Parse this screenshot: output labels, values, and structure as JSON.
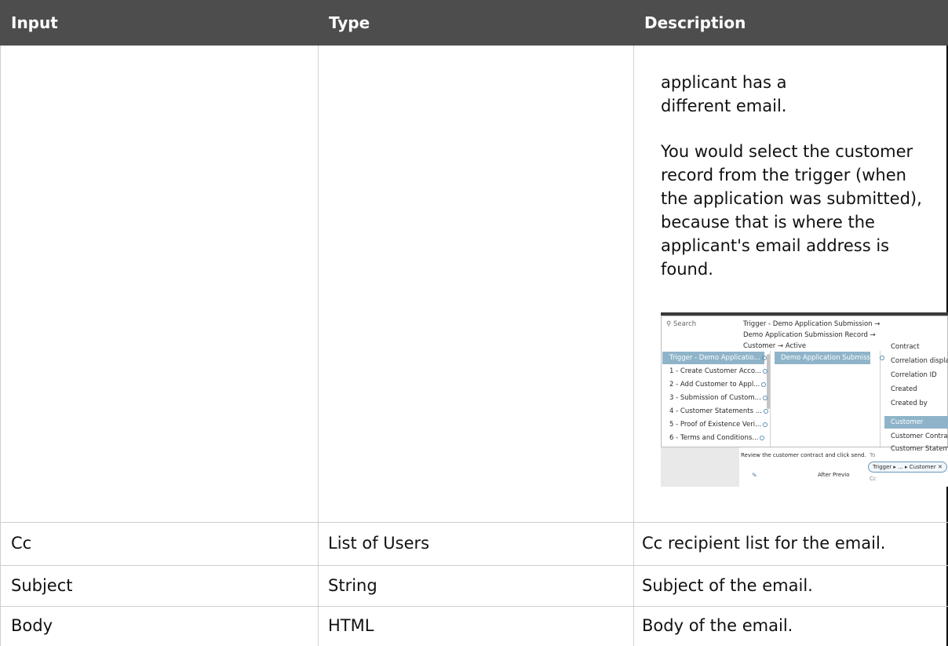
{
  "table": {
    "headers": [
      "Input",
      "Type",
      "Description"
    ],
    "description_continued": [
      "applicant has a different email.",
      "You would select the customer record from the trigger (when the application was submitted), because that is where the applicant's email address is found."
    ],
    "rows": [
      {
        "input": "Cc",
        "type": "List of Users",
        "description": "Cc recipient list for the email."
      },
      {
        "input": "Subject",
        "type": "String",
        "description": "Subject of the email."
      },
      {
        "input": "Body",
        "type": "HTML",
        "description": "Body of the email."
      }
    ]
  },
  "screenshot": {
    "search_placeholder": "Search",
    "breadcrumbs": [
      "Trigger - Demo Application Submission →",
      "Demo Application Submission Record →",
      "Customer → Active"
    ],
    "col1": [
      "Trigger - Demo Applicatio...",
      "1 - Create Customer Acco...",
      "2 - Add Customer to Appl...",
      "3 - Submission of Custom...",
      "4 - Customer Statements ...",
      "5 - Proof of Existence Veri...",
      "6 - Terms and Conditions..."
    ],
    "col2": [
      "Demo Application Submissi..."
    ],
    "col3": [
      "Contract",
      "Correlation display",
      "Correlation ID",
      "Created",
      "Created by",
      "Customer",
      "Customer Contrac",
      "Customer Stateme"
    ],
    "below_text": "Review the customer contract and click send.",
    "after_prev": "After Previo",
    "chip": "Trigger ▸ ... ▸ Customer ✕",
    "cc_label": "Cc",
    "to_label": "To"
  }
}
